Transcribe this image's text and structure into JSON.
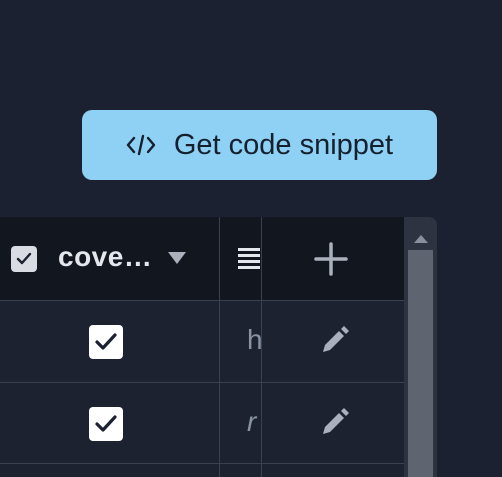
{
  "snippet_button": {
    "label": "Get code snippet",
    "icon": "code-icon"
  },
  "table": {
    "header": {
      "select_all_checked": true,
      "column_label": "cove…",
      "sort_icon": "caret-down-icon",
      "list_icon": "list-icon",
      "add_icon": "plus-icon"
    },
    "rows": [
      {
        "checked": true,
        "text": "h",
        "italic": false,
        "action_icon": "pencil-icon"
      },
      {
        "checked": true,
        "text": "r",
        "italic": true,
        "action_icon": "pencil-icon"
      }
    ]
  },
  "colors": {
    "background": "#1b2130",
    "header_background": "#12161f",
    "accent": "#8fd0f5"
  }
}
